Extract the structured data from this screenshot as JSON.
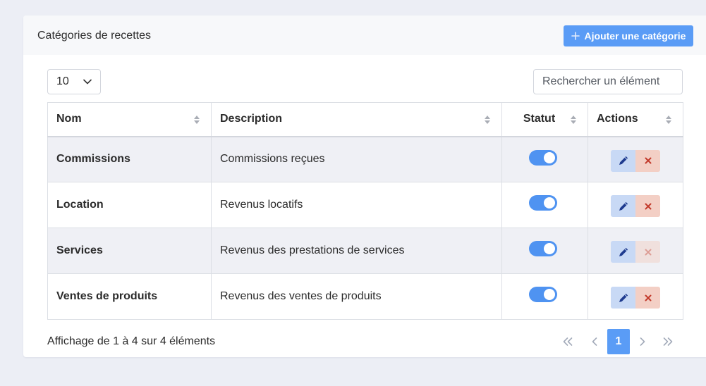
{
  "card": {
    "title": "Catégories de recettes",
    "add_button": {
      "label": "Ajouter une catégorie",
      "icon": "plus-icon"
    }
  },
  "controls": {
    "page_length": {
      "selected": "10",
      "icon": "chevron-down-icon"
    },
    "search": {
      "placeholder": "Rechercher un élément",
      "value": ""
    }
  },
  "table": {
    "columns": [
      "Nom",
      "Description",
      "Statut",
      "Actions"
    ],
    "sort_icon": "sort-icon",
    "rows": [
      {
        "name": "Commissions",
        "description": "Commissions reçues",
        "active": true,
        "delete_disabled": false
      },
      {
        "name": "Location",
        "description": "Revenus locatifs",
        "active": true,
        "delete_disabled": false
      },
      {
        "name": "Services",
        "description": "Revenus des prestations de services",
        "active": true,
        "delete_disabled": true
      },
      {
        "name": "Ventes de produits",
        "description": "Revenus des ventes de produits",
        "active": true,
        "delete_disabled": false
      }
    ],
    "row_actions": {
      "edit_icon": "pencil-icon",
      "delete_icon": "close-icon"
    }
  },
  "footer": {
    "info": "Affichage de 1 à 4 sur 4 éléments",
    "pagination": {
      "current_page": "1",
      "icons": {
        "first": "double-chevron-left-icon",
        "previous": "chevron-left-icon",
        "next": "chevron-right-icon",
        "last": "double-chevron-right-icon"
      }
    }
  },
  "colors": {
    "page_background": "#eceef5",
    "primary": "#5a9cf6",
    "toggle_on": "#4f93f1",
    "edit_button_bg": "#c8d9f5",
    "edit_icon": "#1f3b8f",
    "delete_button_bg": "#f3cfc5",
    "delete_icon": "#c23a2b",
    "striped_row": "#eff0f5"
  }
}
